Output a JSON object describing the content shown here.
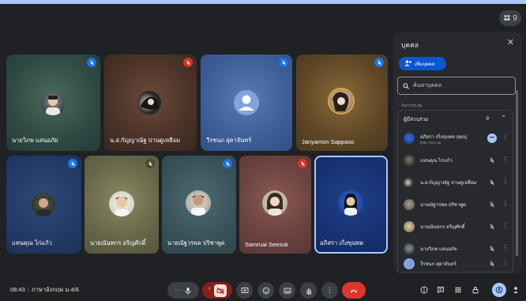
{
  "top_controls": {
    "layout_count": "9"
  },
  "tiles": [
    {
      "name": "นายวิภพ แสนอภัย",
      "mute_color": "#1a73e8"
    },
    {
      "name": "น.ส.กัญญาณัฐ ปานดูเหลือม",
      "mute_color": "#d93025"
    },
    {
      "name": "วีรชนก สุดาจันทร์",
      "mute_color": "#1a73e8"
    },
    {
      "name": "Janyamon Sappaso",
      "mute_color": "#1a73e8"
    },
    {
      "name": "แทนคุณ ไก่แก้ว",
      "mute_color": "#1a73e8"
    },
    {
      "name": "นายณันทกร อริญศักดิ์",
      "mute_color": "#4a4a2f"
    },
    {
      "name": "นายณัฐวรพล ปริชาพูด",
      "mute_color": "#1a73e8"
    },
    {
      "name": "Samruai Seesuk",
      "mute_color": "#d93025"
    },
    {
      "name": "อภิสรา เกิ่งขุนทด",
      "mute_color": ""
    }
  ],
  "panel": {
    "title": "บุคคล",
    "close_label": "✕",
    "add_label": "เพิ่มบุคคล",
    "search_placeholder": "ค้นหาบุคคล",
    "section_caption": "ในการประชุม",
    "list_header": "ผู้มีส่วนร่วม",
    "list_count": "9",
    "people": [
      {
        "name": "อภิสรา เกิ่งขุนทด (คุณ)",
        "sub": "ผู้จัดการประชุม"
      },
      {
        "name": "แทนคุณ ไก่แก้ว",
        "sub": ""
      },
      {
        "name": "น.ส.กัญญาณัฐ ปานดูเหลือม",
        "sub": ""
      },
      {
        "name": "นายณัฐวรพล ปริชาพูด",
        "sub": ""
      },
      {
        "name": "นายณันทกร อริญศักดิ์",
        "sub": ""
      },
      {
        "name": "นายวิภพ แสนอภัย",
        "sub": ""
      },
      {
        "name": "วีรชนก สุดาจันทร์",
        "sub": ""
      }
    ]
  },
  "bottom": {
    "time": "08:43",
    "meeting_name": "ภาษาอังกฤษ ม.4/6"
  },
  "colors": {
    "accent": "#a8c7fa",
    "blue": "#0b57d0",
    "red": "#d93025",
    "background": "#202124"
  }
}
